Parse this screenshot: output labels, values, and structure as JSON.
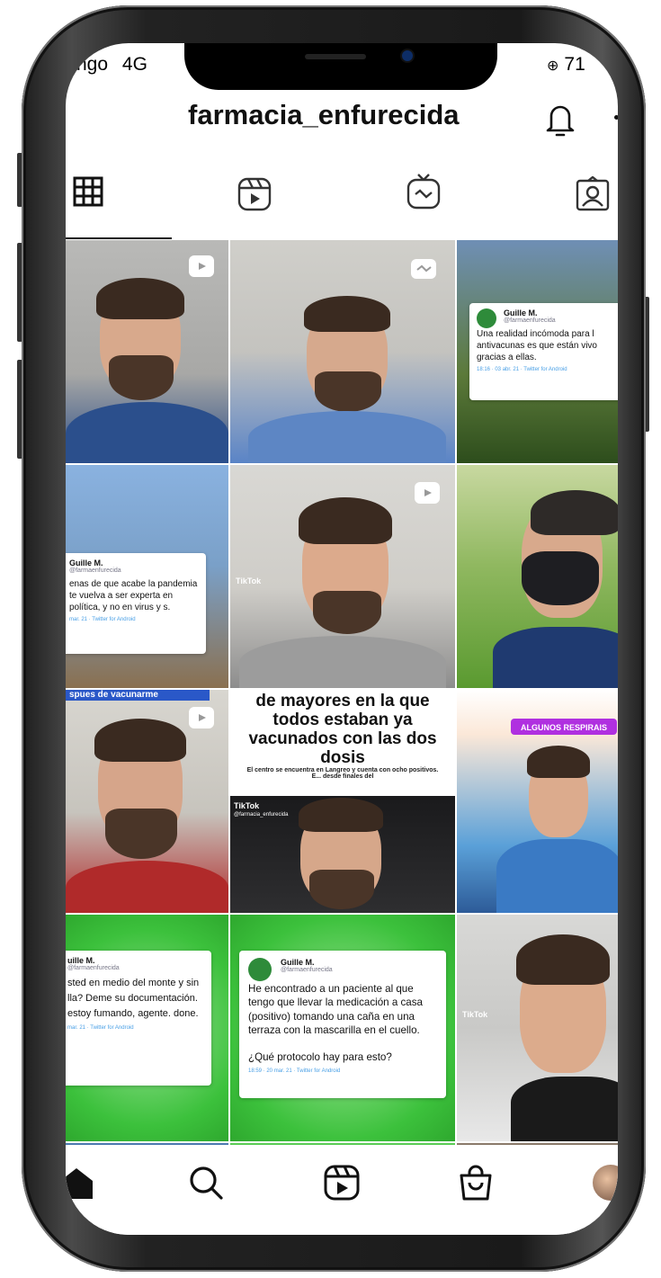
{
  "status_bar": {
    "carrier": "ngo",
    "network": "4G",
    "battery": "71"
  },
  "header": {
    "username": "farmacia_enfurecida"
  },
  "tabs": [
    {
      "name": "grid",
      "icon": "grid-icon"
    },
    {
      "name": "reels",
      "icon": "reels-icon"
    },
    {
      "name": "igtv",
      "icon": "igtv-icon"
    },
    {
      "name": "tagged",
      "icon": "tagged-icon"
    }
  ],
  "posts": {
    "tweet1": {
      "name": "Guille M.",
      "handle": "@farmaenfurecida",
      "body": "Una realidad incómoda para l antivacunas es que están vivo gracias a ellas.",
      "meta": "18:16 · 03 abr. 21 · Twitter for Android"
    },
    "tweet2": {
      "name": "Guille M.",
      "handle": "@farmaenfurecida",
      "body": "enas de que acabe la pandemia te vuelva a ser experta en política, y no en virus y s.",
      "meta": "mar. 21 · Twitter for Android"
    },
    "tile6_banner": "spues de vacunarme",
    "tile8_caption": "de mayores en la que todos estaban ya vacunados con las dos dosis",
    "tile8_subcaption": "El centro se encuentra en Langreo y cuenta con ocho positivos. E... desde finales del",
    "tile8_tiktok": "TikTok",
    "tile8_tiktok_handle": "@farmacia_enfurecida",
    "tile5_tiktok": "TikTok",
    "tile9_badge": "ALGUNOS RESPIRAIS",
    "tweet3": {
      "name": "uille M.",
      "handle": "@farmaenfurecida",
      "body": "sted en medio del monte y sin lla? Deme su documentación. estoy fumando, agente. done.",
      "meta": "mar. 21 · Twitter for Android"
    },
    "tweet4": {
      "name": "Guille M.",
      "handle": "@farmaenfurecida",
      "body": "He encontrado a un paciente al que tengo que llevar la medicación a casa (positivo) tomando una caña en una terraza con la mascarilla en el cuello.\n\n¿Qué protocolo hay para esto?",
      "meta": "18:59 · 20 mar. 21 · Twitter for Android"
    },
    "tile12_tiktok": "TikTok"
  },
  "bottom_nav": [
    {
      "name": "home",
      "icon": "home-icon"
    },
    {
      "name": "search",
      "icon": "search-icon"
    },
    {
      "name": "reels",
      "icon": "reels-icon"
    },
    {
      "name": "shop",
      "icon": "shop-icon"
    },
    {
      "name": "profile",
      "icon": "avatar"
    }
  ],
  "colors": {
    "accent_green": "#3cc13c",
    "badge_purple": "#b030e0",
    "twitter_blue": "#4aa0e6"
  }
}
